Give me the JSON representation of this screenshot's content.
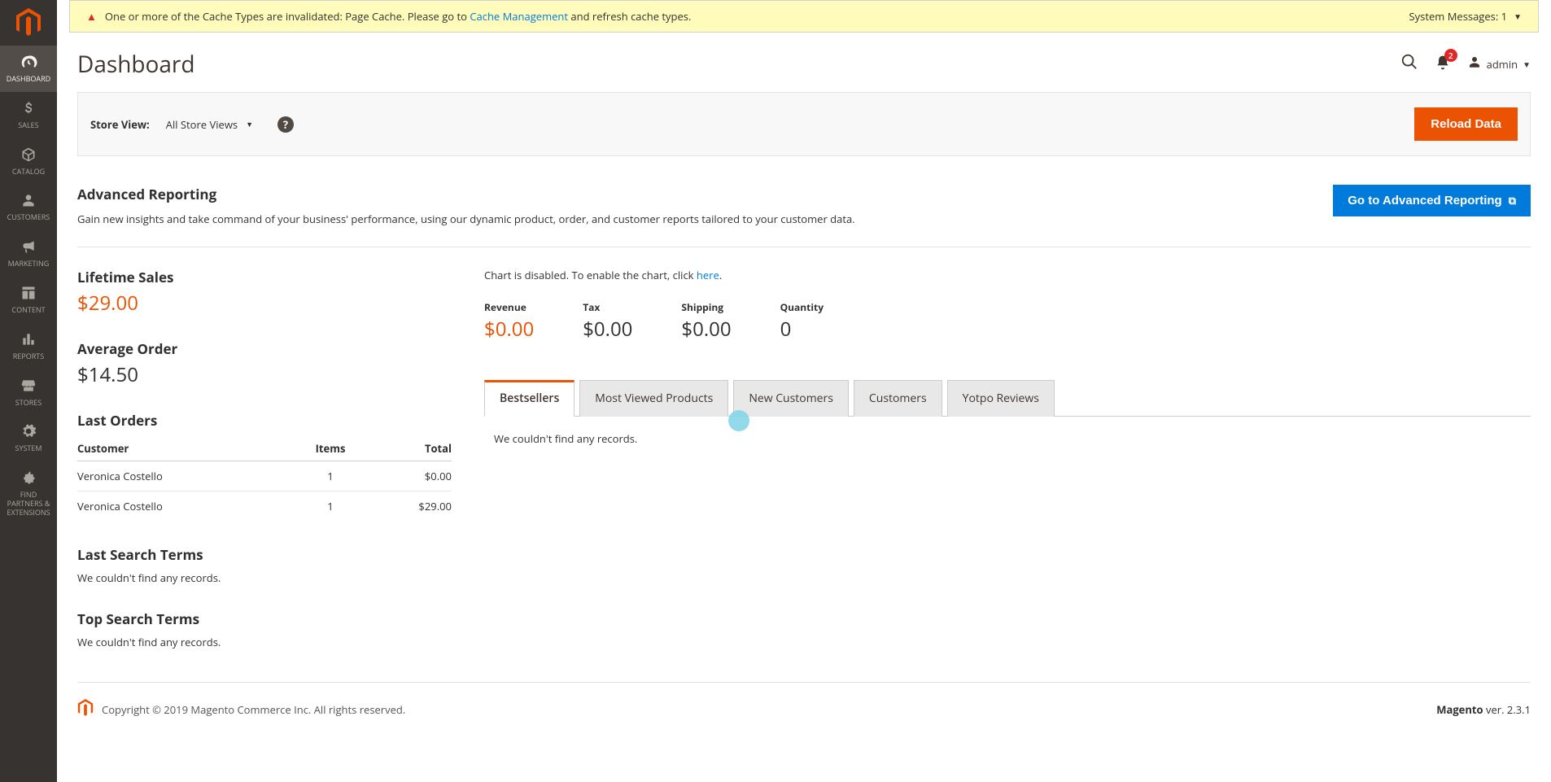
{
  "sidebar": {
    "items": [
      {
        "label": "DASHBOARD",
        "icon": "dashboard"
      },
      {
        "label": "SALES",
        "icon": "dollar"
      },
      {
        "label": "CATALOG",
        "icon": "cube"
      },
      {
        "label": "CUSTOMERS",
        "icon": "person"
      },
      {
        "label": "MARKETING",
        "icon": "megaphone"
      },
      {
        "label": "CONTENT",
        "icon": "layout"
      },
      {
        "label": "REPORTS",
        "icon": "bars"
      },
      {
        "label": "STORES",
        "icon": "storefront"
      },
      {
        "label": "SYSTEM",
        "icon": "gear"
      },
      {
        "label": "FIND PARTNERS & EXTENSIONS",
        "icon": "puzzle"
      }
    ]
  },
  "system_message": {
    "text_before": "One or more of the Cache Types are invalidated: Page Cache. Please go to ",
    "link": "Cache Management",
    "text_after": " and refresh cache types.",
    "count_label": "System Messages: 1"
  },
  "header": {
    "title": "Dashboard",
    "notif_count": "2",
    "user": "admin"
  },
  "store_view": {
    "label": "Store View:",
    "value": "All Store Views",
    "reload_btn": "Reload Data"
  },
  "adv_reporting": {
    "title": "Advanced Reporting",
    "desc": "Gain new insights and take command of your business' performance, using our dynamic product, order, and customer reports tailored to your customer data.",
    "btn": "Go to Advanced Reporting"
  },
  "stats": {
    "lifetime_label": "Lifetime Sales",
    "lifetime_value": "$29.00",
    "avg_label": "Average Order",
    "avg_value": "$14.50"
  },
  "last_orders": {
    "title": "Last Orders",
    "cols": {
      "customer": "Customer",
      "items": "Items",
      "total": "Total"
    },
    "rows": [
      {
        "customer": "Veronica Costello",
        "items": "1",
        "total": "$0.00"
      },
      {
        "customer": "Veronica Costello",
        "items": "1",
        "total": "$29.00"
      }
    ]
  },
  "last_search": {
    "title": "Last Search Terms",
    "empty": "We couldn't find any records."
  },
  "top_search": {
    "title": "Top Search Terms",
    "empty": "We couldn't find any records."
  },
  "chart_disabled": {
    "text_before": "Chart is disabled. To enable the chart, click ",
    "link": "here",
    "text_after": "."
  },
  "totals": {
    "revenue": {
      "label": "Revenue",
      "value": "$0.00"
    },
    "tax": {
      "label": "Tax",
      "value": "$0.00"
    },
    "shipping": {
      "label": "Shipping",
      "value": "$0.00"
    },
    "quantity": {
      "label": "Quantity",
      "value": "0"
    }
  },
  "tabs": {
    "bestsellers": "Bestsellers",
    "most_viewed": "Most Viewed Products",
    "new_customers": "New Customers",
    "customers": "Customers",
    "yotpo": "Yotpo Reviews",
    "empty": "We couldn't find any records."
  },
  "footer": {
    "copyright": "Copyright © 2019 Magento Commerce Inc. All rights reserved.",
    "product": "Magento",
    "ver": " ver. 2.3.1"
  }
}
